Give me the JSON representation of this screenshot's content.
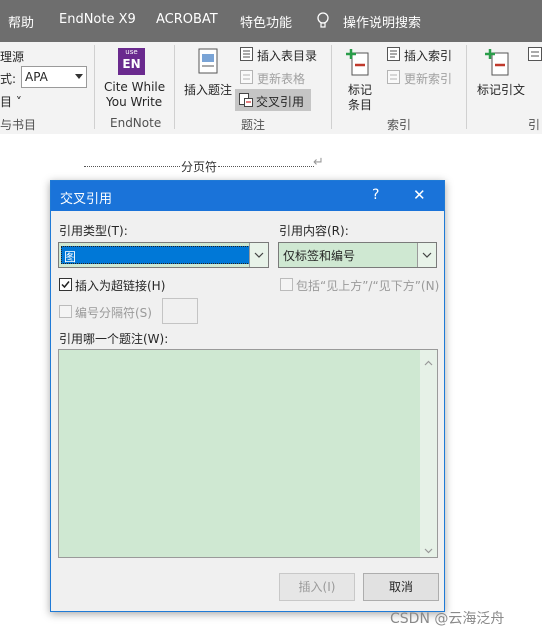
{
  "tabs": [
    "帮助",
    "EndNote X9",
    "ACROBAT",
    "特色功能",
    "操作说明搜索"
  ],
  "ribbon": {
    "left_items": [
      "理源",
      "式:",
      "目 ˅",
      "与书目"
    ],
    "style_value": "APA",
    "endnote_icon": "EN",
    "endnote_icon_small": "use",
    "cite_while": "Cite While",
    "you_write": "You Write",
    "group_endnote": "EndNote",
    "insert_caption": "插入题注",
    "insert_toc": "插入表目录",
    "update_table": "更新表格",
    "cross_ref": "交叉引用",
    "group_caption": "题注",
    "mark_entry_1": "标记",
    "mark_entry_2": "条目",
    "insert_index": "插入索引",
    "update_index": "更新索引",
    "group_index": "索引",
    "mark_citation": "标记引文",
    "group_last": "引"
  },
  "document": {
    "page_break": "分页符",
    "return_mark": "↵"
  },
  "dialog": {
    "title": "交叉引用",
    "help": "?",
    "close": "✕",
    "ref_type_label": "引用类型(T):",
    "ref_type_value": "图",
    "ref_content_label": "引用内容(R):",
    "ref_content_value": "仅标签和编号",
    "insert_hyperlink": "插入为超链接(H)",
    "include_above_below": "包括“见上方”/“见下方”(N)",
    "number_separator": "编号分隔符(S)",
    "which_caption": "引用哪一个题注(W):",
    "insert_button": "插入(I)",
    "cancel_button": "取消"
  },
  "watermark": "CSDN @云海泛舟",
  "colors": {
    "accent": "#1a73d9",
    "list_bg": "#cfe8d2",
    "selection": "#0078d7"
  },
  "icons": [
    "lightbulb-icon",
    "insert-caption-icon",
    "insert-toc-icon",
    "update-table-icon",
    "cross-ref-icon",
    "mark-entry-icon",
    "insert-index-icon",
    "update-index-icon",
    "mark-citation-icon",
    "dropdown-arrow-icon",
    "checkbox-checked-icon",
    "scroll-up-icon",
    "scroll-down-icon"
  ]
}
